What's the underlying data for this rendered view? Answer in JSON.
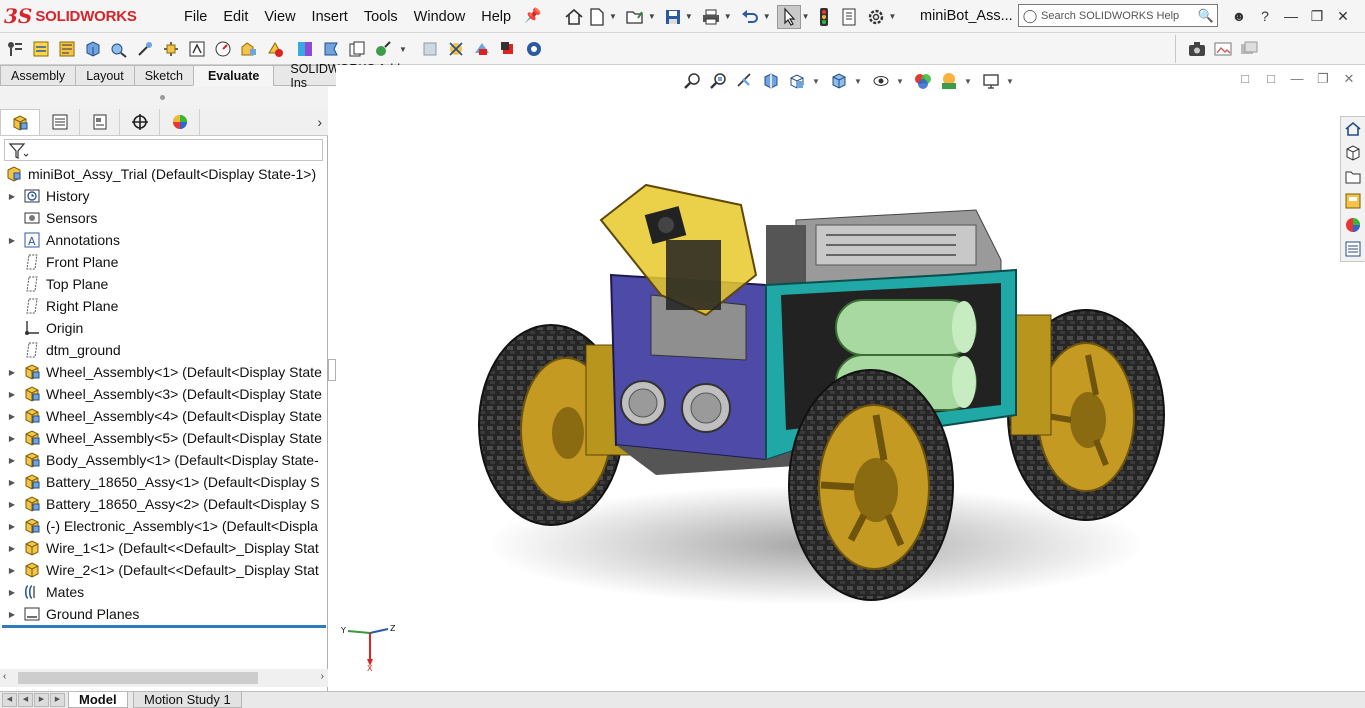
{
  "app": {
    "logo_ds": "3S",
    "logo_text": "SOLIDWORKS",
    "document_title": "miniBot_Ass..."
  },
  "menu": [
    "File",
    "Edit",
    "View",
    "Insert",
    "Tools",
    "Window",
    "Help"
  ],
  "search": {
    "placeholder": "Search SOLIDWORKS Help"
  },
  "command_tabs": [
    {
      "label": "Assembly",
      "active": false
    },
    {
      "label": "Layout",
      "active": false
    },
    {
      "label": "Sketch",
      "active": false
    },
    {
      "label": "Evaluate",
      "active": true
    },
    {
      "label": "SOLIDWORKS Add-Ins",
      "active": false
    }
  ],
  "feature_tree": {
    "root": "miniBot_Assy_Trial  (Default<Display State-1>)",
    "items": [
      {
        "label": "History",
        "expandable": true,
        "icon": "history-folder-icon"
      },
      {
        "label": "Sensors",
        "expandable": false,
        "icon": "sensors-icon"
      },
      {
        "label": "Annotations",
        "expandable": true,
        "icon": "annotations-icon"
      },
      {
        "label": "Front Plane",
        "expandable": false,
        "icon": "plane-icon"
      },
      {
        "label": "Top Plane",
        "expandable": false,
        "icon": "plane-icon"
      },
      {
        "label": "Right Plane",
        "expandable": false,
        "icon": "plane-icon"
      },
      {
        "label": "Origin",
        "expandable": false,
        "icon": "origin-icon"
      },
      {
        "label": "dtm_ground",
        "expandable": false,
        "icon": "plane-icon"
      },
      {
        "label": "Wheel_Assembly<1> (Default<Display State",
        "expandable": true,
        "icon": "subassembly-icon"
      },
      {
        "label": "Wheel_Assembly<3> (Default<Display State",
        "expandable": true,
        "icon": "subassembly-icon"
      },
      {
        "label": "Wheel_Assembly<4> (Default<Display State",
        "expandable": true,
        "icon": "subassembly-icon"
      },
      {
        "label": "Wheel_Assembly<5> (Default<Display State",
        "expandable": true,
        "icon": "subassembly-icon"
      },
      {
        "label": "Body_Assembly<1> (Default<Display State-",
        "expandable": true,
        "icon": "subassembly-icon"
      },
      {
        "label": "Battery_18650_Assy<1> (Default<Display S",
        "expandable": true,
        "icon": "subassembly-icon"
      },
      {
        "label": "Battery_18650_Assy<2> (Default<Display S",
        "expandable": true,
        "icon": "subassembly-icon"
      },
      {
        "label": "(-) Electronic_Assembly<1> (Default<Displa",
        "expandable": true,
        "icon": "subassembly-icon"
      },
      {
        "label": "Wire_1<1> (Default<<Default>_Display Stat",
        "expandable": true,
        "icon": "part-icon"
      },
      {
        "label": "Wire_2<1> (Default<<Default>_Display Stat",
        "expandable": true,
        "icon": "part-icon"
      },
      {
        "label": "Mates",
        "expandable": true,
        "icon": "mates-icon"
      },
      {
        "label": "Ground Planes",
        "expandable": true,
        "icon": "ground-planes-icon"
      }
    ]
  },
  "bottom_tabs": [
    {
      "label": "Model",
      "active": true
    },
    {
      "label": "Motion Study 1",
      "active": false
    }
  ],
  "triad": {
    "x": "X",
    "y": "Y",
    "z": "Z"
  },
  "colors": {
    "brand_red": "#d8232a",
    "rollback_blue": "#2e7bbd",
    "assembly_yellow": "#e8b820",
    "tire": "#2a2a2a",
    "chassis_purple": "#4e4aa8",
    "teal": "#1fa8a6",
    "battery_green": "#a7d9a0",
    "rim_gold": "#c49a22"
  }
}
